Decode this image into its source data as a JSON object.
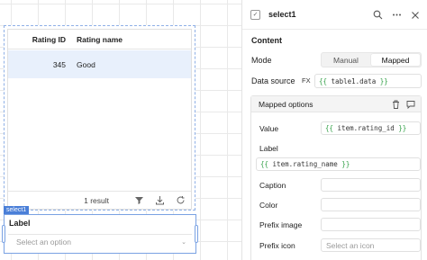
{
  "table": {
    "columns": [
      "Rating ID",
      "Rating name"
    ],
    "rows": [
      [
        "345",
        "Good"
      ]
    ],
    "footer_count": "1 result"
  },
  "select_component": {
    "tag": "select1",
    "label": "Label",
    "placeholder": "Select an option"
  },
  "inspector": {
    "component_name": "select1",
    "section_title": "Content",
    "mode_label": "Mode",
    "mode_options": [
      "Manual",
      "Mapped"
    ],
    "mode_selected": "Mapped",
    "data_source_label": "Data source",
    "fx_label": "FX",
    "data_source_value": {
      "open": "{{",
      "expr": " table1.data ",
      "close": "}}"
    },
    "mapped_options_title": "Mapped options",
    "value_label": "Value",
    "value_expr": {
      "open": "{{",
      "expr": " item.rating_id ",
      "close": "}}"
    },
    "label_label": "Label",
    "label_expr": {
      "open": "{{",
      "expr": " item.rating_name ",
      "close": "}}"
    },
    "caption_label": "Caption",
    "color_label": "Color",
    "prefix_image_label": "Prefix image",
    "prefix_icon_label": "Prefix icon",
    "prefix_icon_placeholder": "Select an icon"
  },
  "colors": {
    "accent": "#4a7fd8",
    "selected_row": "#e8f0fc",
    "code_brace": "#2f9e44"
  }
}
